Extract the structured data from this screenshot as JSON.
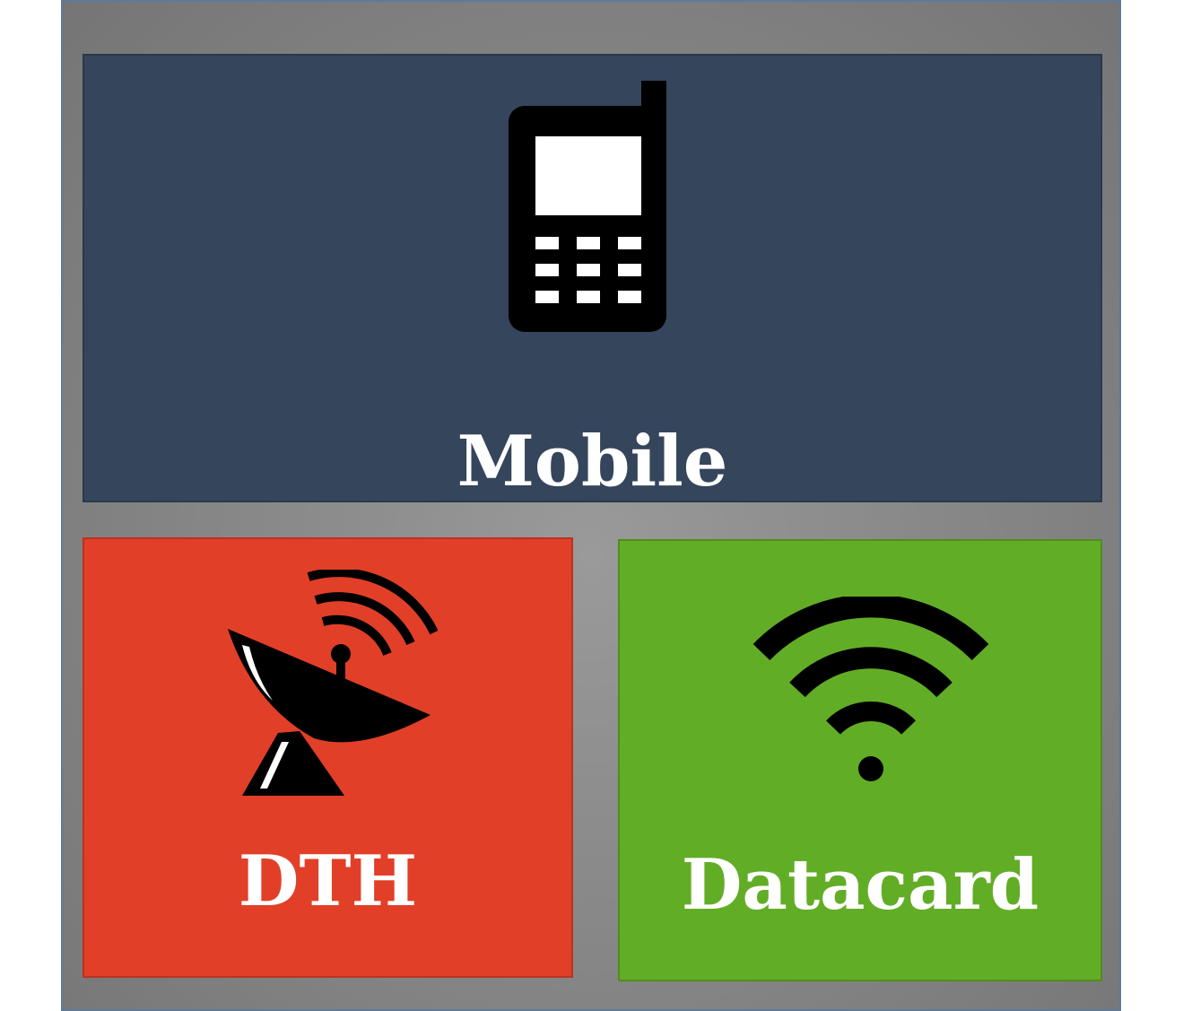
{
  "menu": {
    "tiles": [
      {
        "label": "Mobile",
        "icon": "mobile-phone-icon",
        "color": "#34455c"
      },
      {
        "label": "DTH",
        "icon": "satellite-dish-icon",
        "color": "#e23f28"
      },
      {
        "label": "Datacard",
        "icon": "wifi-icon",
        "color": "#62ad26"
      }
    ],
    "frame_color": "#8a8a8a"
  }
}
